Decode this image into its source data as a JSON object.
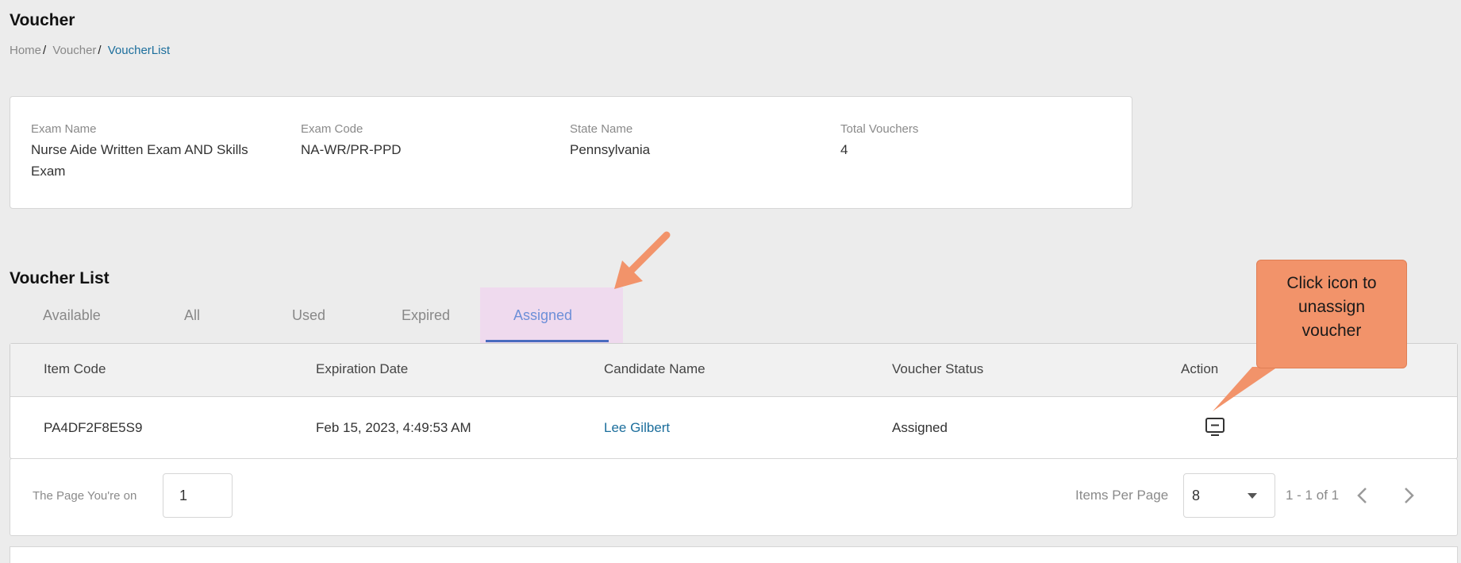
{
  "header": {
    "title": "Voucher",
    "breadcrumb": [
      "Home",
      "Voucher",
      "VoucherList"
    ]
  },
  "exam_info": {
    "exam_name_label": "Exam Name",
    "exam_name_value_line1": "Nurse Aide Written Exam AND Skills",
    "exam_name_value_line2": "Exam",
    "exam_code_label": "Exam Code",
    "exam_code_value": "NA-WR/PR-PPD",
    "state_name_label": "State Name",
    "state_name_value": "Pennsylvania",
    "total_vouchers_label": "Total Vouchers",
    "total_vouchers_value": "4"
  },
  "voucher_list": {
    "title": "Voucher List",
    "tabs": [
      {
        "label": "Available"
      },
      {
        "label": "All"
      },
      {
        "label": "Used"
      },
      {
        "label": "Expired"
      },
      {
        "label": "Assigned",
        "active": true
      }
    ],
    "columns": [
      "Item Code",
      "Expiration Date",
      "Candidate Name",
      "Voucher Status",
      "Action"
    ],
    "rows": [
      {
        "item_code": "PA4DF2F8E5S9",
        "expiration_date": "Feb 15, 2023, 4:49:53 AM",
        "candidate_name": "Lee Gilbert",
        "voucher_status": "Assigned",
        "action_icon": "unassign-icon"
      }
    ]
  },
  "pagination": {
    "page_label": "The Page You're on",
    "page_value": "1",
    "items_per_page_label": "Items Per Page",
    "items_per_page_value": "8",
    "range_text": "1 - 1 of 1"
  },
  "annotation": {
    "callout_line1": "Click icon to",
    "callout_line2": "unassign",
    "callout_line3": "voucher",
    "color": "#f2936a"
  }
}
